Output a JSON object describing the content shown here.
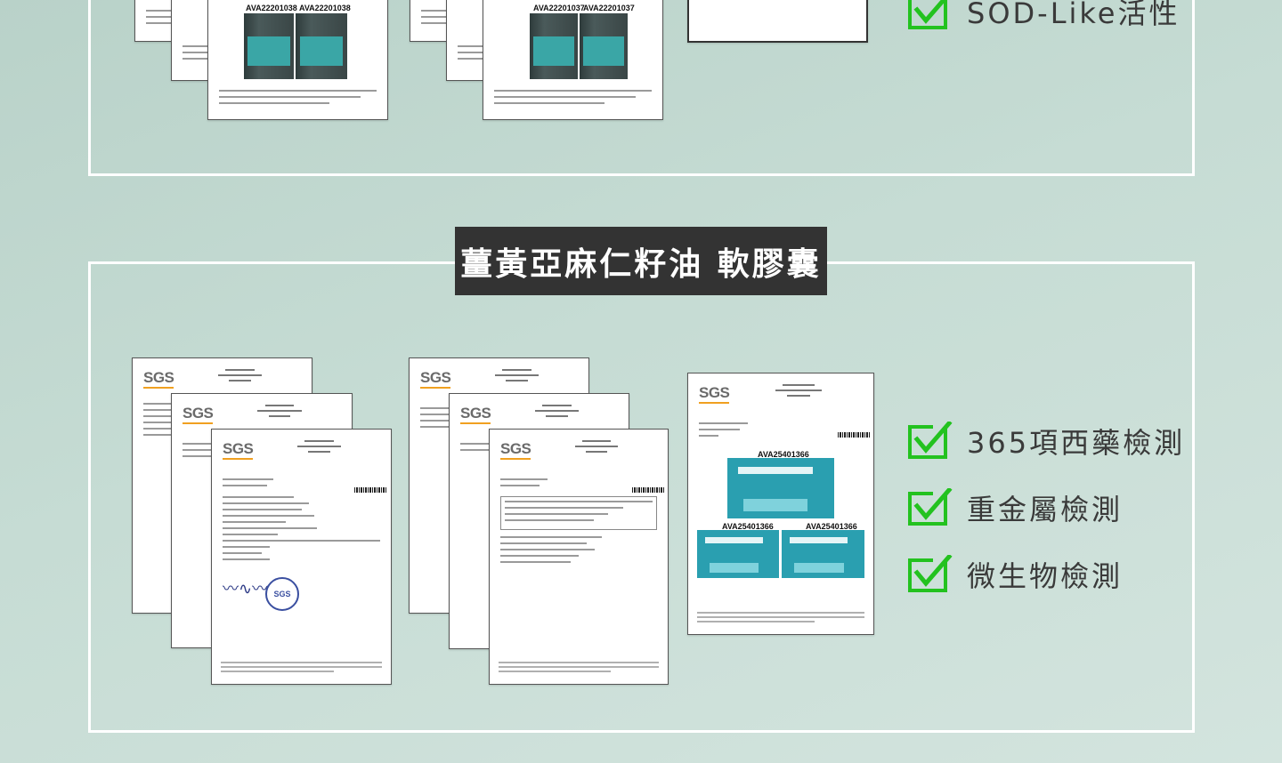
{
  "section_top": {
    "checks": [
      {
        "label": "SOD-Like活性",
        "icon": "check-icon"
      }
    ],
    "certificates": [
      {
        "photo_codes": [
          "AVA22201038",
          "AVA22201038"
        ]
      },
      {
        "photo_codes": [
          "AVA22201037",
          "AVA22201037"
        ]
      }
    ]
  },
  "section_bottom": {
    "title": "薑黃亞麻仁籽油 軟膠囊",
    "certificates": [
      {
        "logo": "SGS",
        "stamp": "SGS"
      },
      {
        "logo": "SGS"
      },
      {
        "logo": "SGS",
        "photo_codes": [
          "AVA25401366",
          "AVA25401366",
          "AVA25401366"
        ]
      }
    ],
    "checks": [
      {
        "label": "365項西藥檢測",
        "icon": "check-icon"
      },
      {
        "label": "重金屬檢測",
        "icon": "check-icon"
      },
      {
        "label": "微生物檢測",
        "icon": "check-icon"
      }
    ]
  },
  "colors": {
    "check": "#23c21f",
    "title_bg": "#333333",
    "frame": "#ffffff",
    "background": "#c6dcd4"
  }
}
